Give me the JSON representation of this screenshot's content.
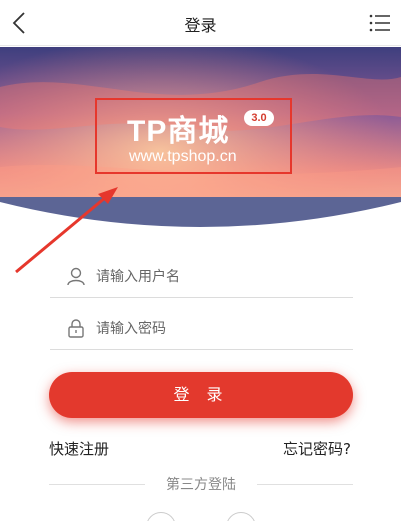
{
  "header": {
    "title": "登录",
    "back_icon": "chevron-left-icon",
    "menu_icon": "list-menu-icon"
  },
  "banner": {
    "logo_text": "TP商城",
    "logo_version": "3.0",
    "logo_url": "www.tpshop.cn",
    "highlight_color": "#e6372c"
  },
  "form": {
    "username_placeholder": "请输入用户名",
    "password_placeholder": "请输入密码",
    "login_label": "登 录"
  },
  "links": {
    "register": "快速注册",
    "forgot": "忘记密码?"
  },
  "third_party": {
    "label": "第三方登陆"
  },
  "colors": {
    "accent": "#e3392d"
  }
}
